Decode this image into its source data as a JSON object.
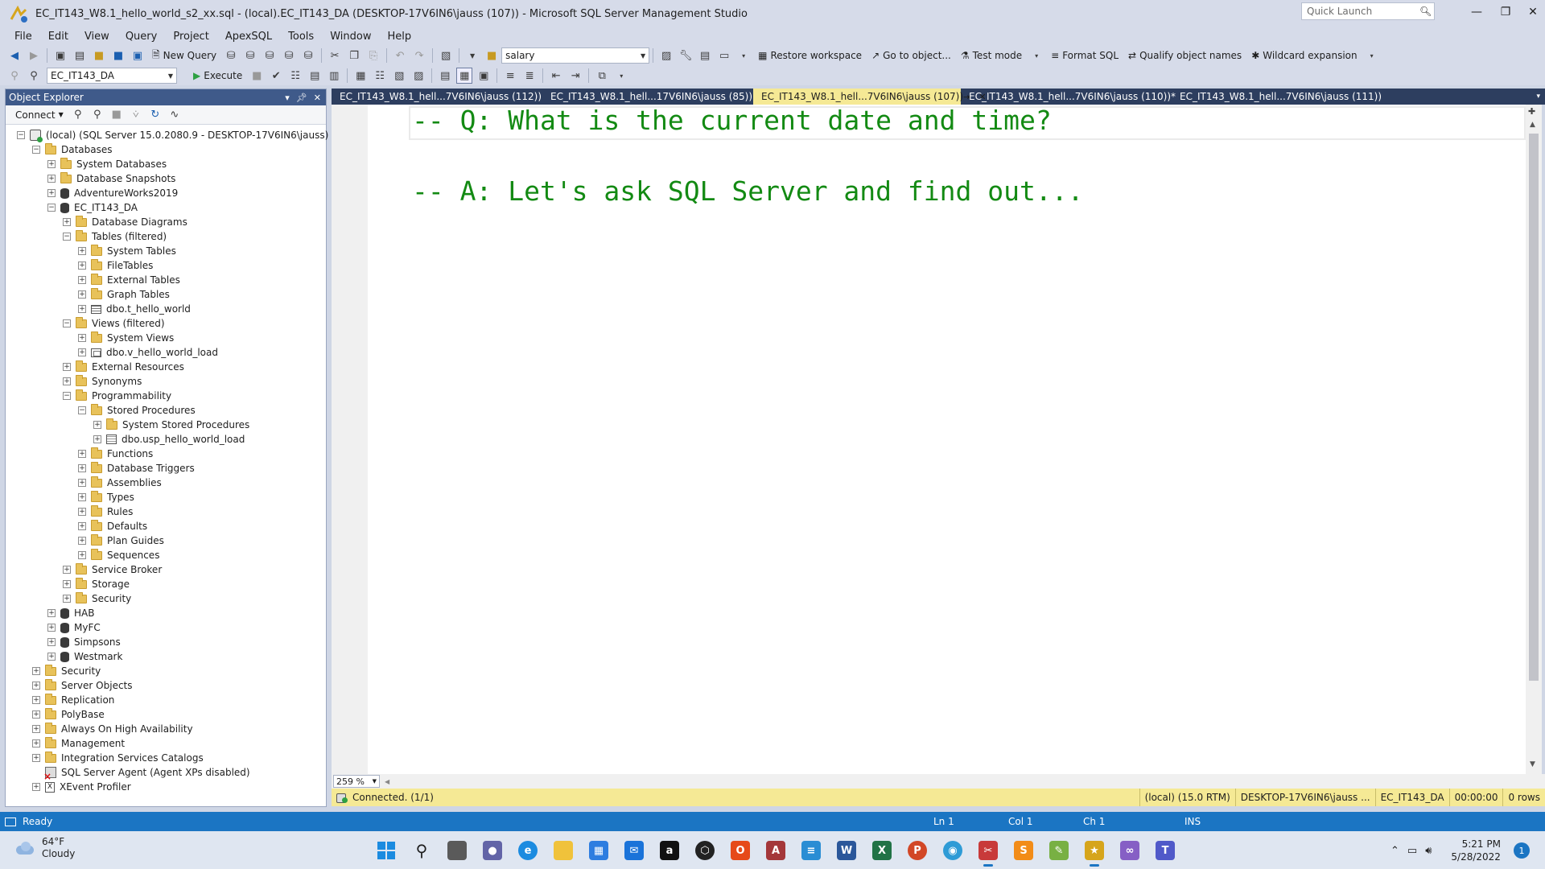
{
  "window": {
    "title": "EC_IT143_W8.1_hello_world_s2_xx.sql - (local).EC_IT143_DA (DESKTOP-17V6IN6\\jauss (107)) - Microsoft SQL Server Management Studio",
    "quick_launch_placeholder": "Quick Launch"
  },
  "menu": [
    "File",
    "Edit",
    "View",
    "Query",
    "Project",
    "ApexSQL",
    "Tools",
    "Window",
    "Help"
  ],
  "toolbar": {
    "new_query": "New Query",
    "search_combo_value": "salary",
    "restore_workspace": "Restore workspace",
    "go_to_object": "Go to object...",
    "test_mode": "Test mode",
    "format_sql": "Format SQL",
    "qualify_object_names": "Qualify object names",
    "wildcard_expansion": "Wildcard expansion",
    "database_combo_value": "EC_IT143_DA",
    "execute": "Execute"
  },
  "object_explorer": {
    "title": "Object Explorer",
    "connect": "Connect",
    "tree": [
      {
        "level": 0,
        "toggle": "-",
        "icon": "server",
        "label": "(local) (SQL Server 15.0.2080.9 - DESKTOP-17V6IN6\\jauss)"
      },
      {
        "level": 1,
        "toggle": "-",
        "icon": "folder",
        "label": "Databases"
      },
      {
        "level": 2,
        "toggle": "+",
        "icon": "folder",
        "label": "System Databases"
      },
      {
        "level": 2,
        "toggle": "+",
        "icon": "folder",
        "label": "Database Snapshots"
      },
      {
        "level": 2,
        "toggle": "+",
        "icon": "db",
        "label": "AdventureWorks2019"
      },
      {
        "level": 2,
        "toggle": "-",
        "icon": "db",
        "label": "EC_IT143_DA"
      },
      {
        "level": 3,
        "toggle": "+",
        "icon": "folder",
        "label": "Database Diagrams"
      },
      {
        "level": 3,
        "toggle": "-",
        "icon": "folder",
        "label": "Tables (filtered)"
      },
      {
        "level": 4,
        "toggle": "+",
        "icon": "folder",
        "label": "System Tables"
      },
      {
        "level": 4,
        "toggle": "+",
        "icon": "folder",
        "label": "FileTables"
      },
      {
        "level": 4,
        "toggle": "+",
        "icon": "folder",
        "label": "External Tables"
      },
      {
        "level": 4,
        "toggle": "+",
        "icon": "folder",
        "label": "Graph Tables"
      },
      {
        "level": 4,
        "toggle": "+",
        "icon": "table",
        "label": "dbo.t_hello_world"
      },
      {
        "level": 3,
        "toggle": "-",
        "icon": "folder",
        "label": "Views (filtered)"
      },
      {
        "level": 4,
        "toggle": "+",
        "icon": "folder",
        "label": "System Views"
      },
      {
        "level": 4,
        "toggle": "+",
        "icon": "view",
        "label": "dbo.v_hello_world_load"
      },
      {
        "level": 3,
        "toggle": "+",
        "icon": "folder",
        "label": "External Resources"
      },
      {
        "level": 3,
        "toggle": "+",
        "icon": "folder",
        "label": "Synonyms"
      },
      {
        "level": 3,
        "toggle": "-",
        "icon": "folder",
        "label": "Programmability"
      },
      {
        "level": 4,
        "toggle": "-",
        "icon": "folder",
        "label": "Stored Procedures"
      },
      {
        "level": 5,
        "toggle": "+",
        "icon": "folder",
        "label": "System Stored Procedures"
      },
      {
        "level": 5,
        "toggle": "+",
        "icon": "proc",
        "label": "dbo.usp_hello_world_load"
      },
      {
        "level": 4,
        "toggle": "+",
        "icon": "folder",
        "label": "Functions"
      },
      {
        "level": 4,
        "toggle": "+",
        "icon": "folder",
        "label": "Database Triggers"
      },
      {
        "level": 4,
        "toggle": "+",
        "icon": "folder",
        "label": "Assemblies"
      },
      {
        "level": 4,
        "toggle": "+",
        "icon": "folder",
        "label": "Types"
      },
      {
        "level": 4,
        "toggle": "+",
        "icon": "folder",
        "label": "Rules"
      },
      {
        "level": 4,
        "toggle": "+",
        "icon": "folder",
        "label": "Defaults"
      },
      {
        "level": 4,
        "toggle": "+",
        "icon": "folder",
        "label": "Plan Guides"
      },
      {
        "level": 4,
        "toggle": "+",
        "icon": "folder",
        "label": "Sequences"
      },
      {
        "level": 3,
        "toggle": "+",
        "icon": "folder",
        "label": "Service Broker"
      },
      {
        "level": 3,
        "toggle": "+",
        "icon": "folder",
        "label": "Storage"
      },
      {
        "level": 3,
        "toggle": "+",
        "icon": "folder",
        "label": "Security"
      },
      {
        "level": 2,
        "toggle": "+",
        "icon": "db",
        "label": "HAB"
      },
      {
        "level": 2,
        "toggle": "+",
        "icon": "db",
        "label": "MyFC"
      },
      {
        "level": 2,
        "toggle": "+",
        "icon": "db",
        "label": "Simpsons"
      },
      {
        "level": 2,
        "toggle": "+",
        "icon": "db",
        "label": "Westmark"
      },
      {
        "level": 1,
        "toggle": "+",
        "icon": "folder",
        "label": "Security"
      },
      {
        "level": 1,
        "toggle": "+",
        "icon": "folder",
        "label": "Server Objects"
      },
      {
        "level": 1,
        "toggle": "+",
        "icon": "folder",
        "label": "Replication"
      },
      {
        "level": 1,
        "toggle": "+",
        "icon": "folder",
        "label": "PolyBase"
      },
      {
        "level": 1,
        "toggle": "+",
        "icon": "folder",
        "label": "Always On High Availability"
      },
      {
        "level": 1,
        "toggle": "+",
        "icon": "folder",
        "label": "Management"
      },
      {
        "level": 1,
        "toggle": "+",
        "icon": "folder",
        "label": "Integration Services Catalogs"
      },
      {
        "level": 1,
        "toggle": "",
        "icon": "agent",
        "label": "SQL Server Agent (Agent XPs disabled)"
      },
      {
        "level": 1,
        "toggle": "+",
        "icon": "xe",
        "label": "XEvent Profiler"
      }
    ]
  },
  "doc_tabs": [
    {
      "label": "EC_IT143_W8.1_hell...7V6IN6\\jauss (112))",
      "active": false
    },
    {
      "label": "EC_IT143_W8.1_hell...17V6IN6\\jauss (85))",
      "active": false
    },
    {
      "label": "EC_IT143_W8.1_hell...7V6IN6\\jauss (107))",
      "active": true
    },
    {
      "label": "EC_IT143_W8.1_hell...7V6IN6\\jauss (110))*",
      "active": false
    },
    {
      "label": "EC_IT143_W8.1_hell...7V6IN6\\jauss (111))",
      "active": false
    }
  ],
  "editor": {
    "line1": "-- Q: What is the current date and time?",
    "line2": "-- A: Let's ask SQL Server and find out...",
    "zoom": "259 %"
  },
  "query_status": {
    "connection": "Connected. (1/1)",
    "server": "(local) (15.0 RTM)",
    "user": "DESKTOP-17V6IN6\\jauss ...",
    "database": "EC_IT143_DA",
    "elapsed": "00:00:00",
    "rows": "0 rows"
  },
  "status_bar": {
    "ready": "Ready",
    "ln": "Ln 1",
    "col": "Col 1",
    "ch": "Ch 1",
    "mode": "INS"
  },
  "taskbar": {
    "weather_temp": "64°F",
    "weather_desc": "Cloudy",
    "time": "5:21 PM",
    "date": "5/28/2022",
    "notifications": "1"
  },
  "colors": {
    "accent": "#1b75c3",
    "code_comment": "#138a13",
    "active_tab": "#f5e995"
  }
}
